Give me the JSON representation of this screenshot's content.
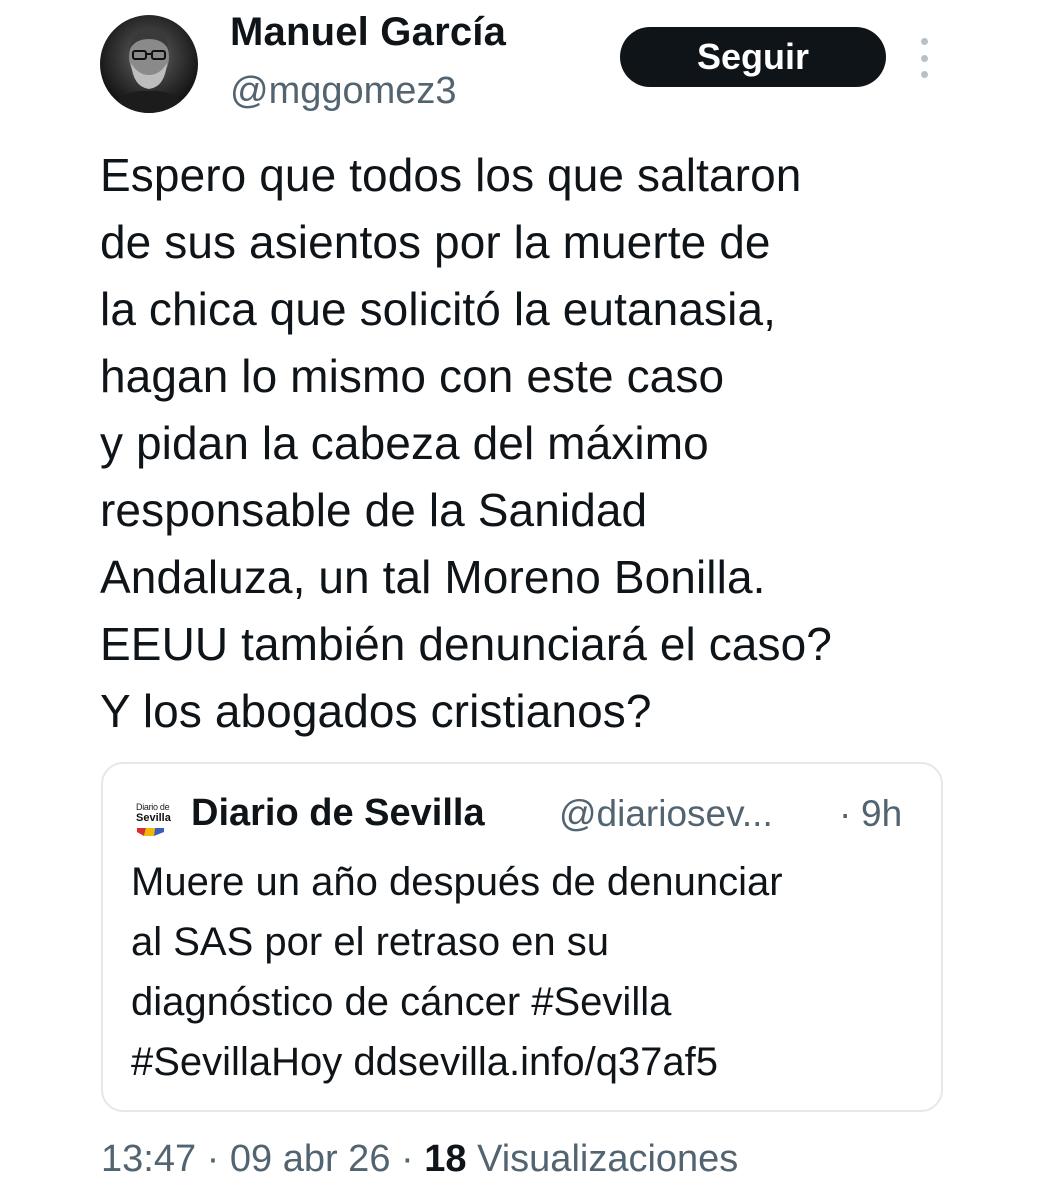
{
  "author": {
    "display_name": "Manuel García",
    "handle": "@mggomez3",
    "avatar": "user-avatar-photo"
  },
  "actions": {
    "follow_label": "Seguir",
    "more_icon": "more-vertical-icon"
  },
  "tweet": {
    "text": "Espero que todos los que saltaron\nde sus asientos por la muerte de\nla chica que solicitó la eutanasia,\nhagan lo mismo con este caso\ny pidan la cabeza del máximo\nresponsable de la Sanidad\nAndaluza, un tal Moreno Bonilla.\nEEUU también denunciará el caso?\nY los abogados cristianos?"
  },
  "quote": {
    "logo_top": "Diario de",
    "logo_main": "Sevilla",
    "name": "Diario de Sevilla",
    "handle": "@diariosev...",
    "separator": "·",
    "time": "9h",
    "text": "Muere un año después de denunciar\nal SAS por el retraso en su\ndiagnóstico de cáncer #Sevilla\n#SevillaHoy ddsevilla.info/q37af5"
  },
  "meta": {
    "time": "13:47",
    "sep1": " · ",
    "date": "09 abr 26",
    "sep2": " · ",
    "views_count": "18",
    "views_label": " Visualizaciones"
  },
  "colors": {
    "text": "#0f1419",
    "secondary": "#536471",
    "button_bg": "#0f1419",
    "button_text": "#ffffff",
    "border": "#e3e8ec"
  }
}
